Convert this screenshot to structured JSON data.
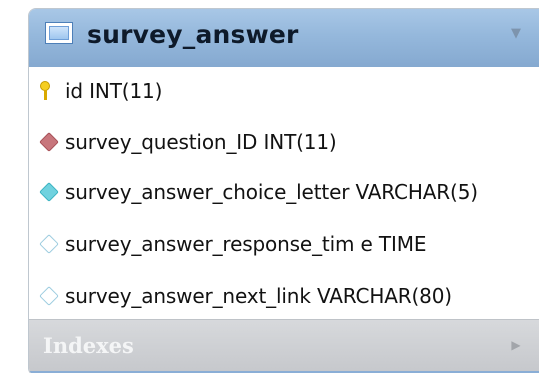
{
  "diagram": {
    "table": {
      "name": "survey_answer",
      "columns": [
        {
          "text": "id INT(11)",
          "icon": "primary-key-icon"
        },
        {
          "text": "survey_question_ID INT(11)",
          "icon": "foreign-key-diamond-icon"
        },
        {
          "text": "survey_answer_choice_letter VARCHAR(5)",
          "icon": "not-null-diamond-icon"
        },
        {
          "text": "survey_answer_response_tim e TIME",
          "icon": "nullable-diamond-icon"
        },
        {
          "text": "survey_answer_next_link VARCHAR(80)",
          "icon": "nullable-diamond-icon"
        }
      ],
      "indexes_label": "Indexes"
    },
    "colors": {
      "header": "#95b8dc",
      "foreign_key": "#c8767c",
      "not_null": "#70d2df",
      "nullable_outline": "#9ecde0",
      "index_bar": "#c6c8cc"
    }
  }
}
